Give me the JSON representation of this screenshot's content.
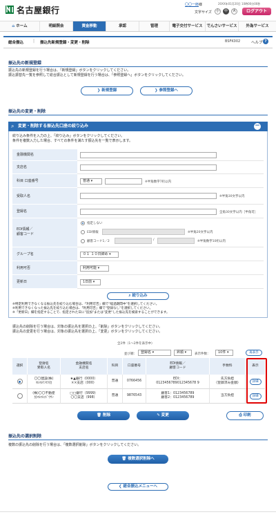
{
  "header": {
    "bank_name": "名古屋銀行",
    "user_name": "〇〇一郎",
    "user_suffix": "様",
    "last_login": "20XX年01月20日 10時00分00秒",
    "font_size_label": "文字サイズ",
    "font_sizes": [
      "小",
      "中",
      "大"
    ],
    "logout_label": "ログアウト"
  },
  "nav": {
    "items": [
      "ホーム",
      "明細照会",
      "資金移動",
      "承認",
      "管理",
      "電子交付サービス",
      "でんさいサービス",
      "外為サービス"
    ],
    "active_index": 2
  },
  "subheader": {
    "breadcrumb": [
      "総合振込",
      "振込先新規登録・変更・削除"
    ],
    "screen_id": "BSFK002",
    "help_label": "ヘルプ"
  },
  "new_registration": {
    "title": "振込先の新規登録",
    "note_lines": [
      "振込先の新規登録を行う場合は、「新規登録」ボタンをクリックしてください。",
      "振込振替先一覧を参照して総合振込として新規登録を行う場合は、「参照登録へ」ボタンをクリックしてください。"
    ],
    "new_button": "新規登録",
    "ref_button": "参照登録へ"
  },
  "change_delete": {
    "title": "振込先の変更・削除",
    "panel_title": "変更・削除する振込先口座の絞り込み",
    "panel_note_lines": [
      "絞り込み条件を入力の上、「絞り込み」ボタンをクリックしてください。",
      "条件を複数入力した場合、すべての条件を満たす振込先を一覧で表示します。"
    ],
    "fields": {
      "bank_name": "金融機関名",
      "branch_name": "支店名",
      "account": "科目 口座番号",
      "account_type": "普通",
      "account_hint": "※半角数字7桁以内",
      "payee_name": "受取人名",
      "payee_hint": "※半角30文字以内",
      "reg_name": "登録名",
      "reg_hint": "全角30文字以内［半角可］",
      "edi_label_1": "EDI情報／",
      "edi_label_2": "顧客コード",
      "edi_opt_none": "指定しない",
      "edi_opt_edi": "EDI情報",
      "edi_hint": "※半角20文字以内",
      "edi_opt_code": "顧客コード1／2",
      "code_hint": "※半角数字10桁以内",
      "group_name": "グループ名",
      "group_value": "０１ １０日締め",
      "usable": "利用可否",
      "usable_value": "利用可能",
      "update_date": "更新日",
      "update_value": "1日前"
    },
    "filter_button": "絞り込み",
    "warn_lines": [
      "※特定利用できなくなる振込先を絞り込む場合は、「利用可否」欄で\"経過期間中\"を選択してください。",
      "※利用できなくなった振込先を絞り込む場合は、「利用可否」欄で\"登録なし\"を選択してください。",
      "※「更新日」欄を指定することで、指定された日に\"追加\"または\"変更\"した振込先を検索することができます。"
    ],
    "instr_lines": [
      "振込先の削除を行う場合は、対象の振込先を選択の上、「削除」ボタンをクリックしてください。",
      "振込先の変更を行う場合は、対象の振込先を選択の上、「変更」ボタンをクリックしてください。"
    ],
    "count_text": "全2件（1〜2件を表示中）",
    "sort_label": "並び順：",
    "sort_value": "登録名",
    "order_value": "昇順",
    "per_page_label": "表示件数：",
    "per_page_value": "10件",
    "redisplay": "再表示",
    "columns": [
      "選択",
      "登録名\n受取人名",
      "金融機関名\n支店名",
      "科目",
      "口座番号",
      "EDI情報／\n顧客コード",
      "手数料",
      "詳細"
    ],
    "rows": [
      {
        "reg_name": "〇〇建設(株)",
        "payee_kana": "ﾏﾙﾏﾙｹﾝｾﾂ(ｶ",
        "bank": "★▲銀行（0000）",
        "branch": "××支店（000）",
        "type": "普通",
        "account_no": "0766456",
        "edi_1": "EDI：",
        "edi_2": "0123456789012345678 9",
        "fee_1": "先方負担",
        "fee_2": "（登録済み金額）",
        "detail": "詳細",
        "selected": true
      },
      {
        "reg_name": "(株)〇〇不動産",
        "payee_kana": "ｶ)ﾏﾙﾏﾙﾌﾄﾞｳｻﾝ",
        "bank": "□□銀行（9999）",
        "branch": "〇〇支店（998）",
        "type": "普通",
        "account_no": "9876543",
        "edi_1": "顧客1：0123456789",
        "edi_2": "顧客2：0123456789",
        "fee_1": "当方負担",
        "fee_2": "",
        "detail": "詳細",
        "selected": false
      }
    ],
    "delete_button": "削除",
    "change_button": "変更",
    "print_button": "印刷"
  },
  "bulk_delete": {
    "title": "振込先の選択削除",
    "note": "複数の振込先の削除を行う場合は、「複数選択削除」ボタンをクリックしてください。",
    "button": "複数選択削除へ"
  },
  "back_button": "総合振込メニューへ",
  "colors": {
    "primary": "#2c6db4",
    "logout": "#d63384",
    "highlight": "#e00000"
  }
}
